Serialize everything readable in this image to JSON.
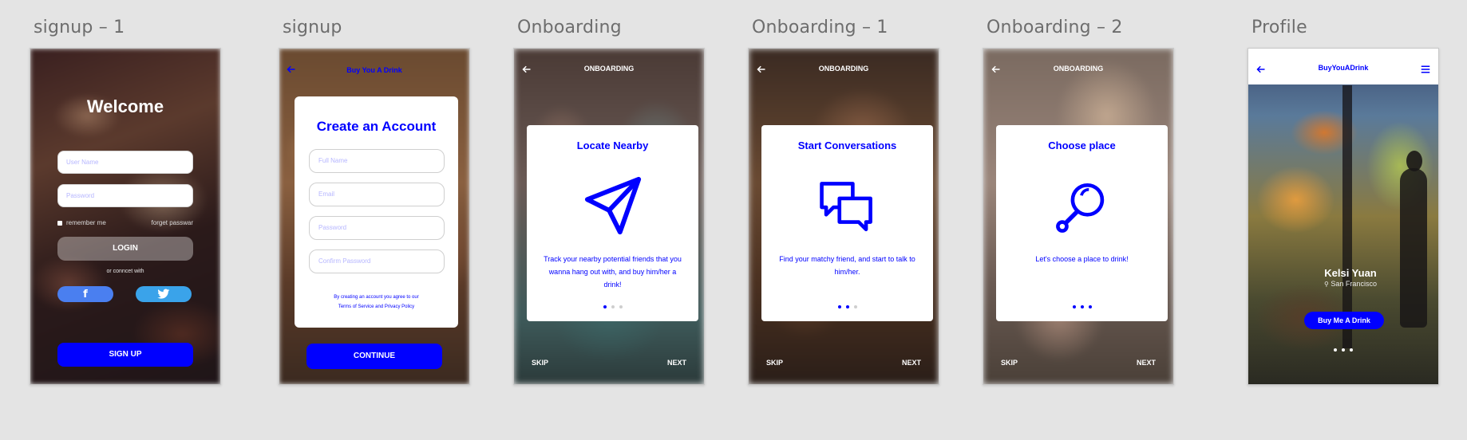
{
  "colors": {
    "accent": "#0000ff",
    "canvas": "#e4e4e4",
    "card": "#ffffff",
    "facebook": "#4a7ff0",
    "twitter": "#3aa3ea"
  },
  "artboards": {
    "signup1": {
      "title": "signup – 1",
      "welcome": "Welcome",
      "username_placeholder": "User Name",
      "password_placeholder": "Password",
      "remember_me": "remember me",
      "forget_password": "forget passwar",
      "login": "LOGIN",
      "connect_with": "or conncet with",
      "facebook_icon": "facebook-icon",
      "twitter_icon": "twitter-icon",
      "signup_button": "SIGN UP"
    },
    "signup": {
      "title": "signup",
      "header": "Buy You A Drink",
      "card_title": "Create an Account",
      "full_name": "Full Name",
      "email": "Email",
      "password": "Password",
      "confirm_password": "Confirm Password",
      "terms_line1": "By creating an account you agree to our",
      "terms_line2": "Terms of Service and Privacy Policy",
      "continue": "CONTINUE"
    },
    "onboarding": {
      "title": "Onboarding",
      "header": "ONBOARDING",
      "card_title": "Locate Nearby",
      "icon": "navigation-arrow-icon",
      "text": "Track your nearby potential friends that you wanna hang out with, and buy him/her a drink!",
      "page": 1,
      "pages": 3,
      "skip": "SKIP",
      "next": "NEXT"
    },
    "onboarding1": {
      "title": "Onboarding – 1",
      "header": "ONBOARDING",
      "card_title": "Start Conversations",
      "icon": "chat-bubbles-icon",
      "text": "Find your matchy friend, and start to talk to him/her.",
      "page": 2,
      "pages": 3,
      "skip": "SKIP",
      "next": "NEXT"
    },
    "onboarding2": {
      "title": "Onboarding – 2",
      "header": "ONBOARDING",
      "card_title": "Choose place",
      "icon": "magnifier-icon",
      "text": "Let's choose a place to drink!",
      "page": 3,
      "pages": 3,
      "skip": "SKIP",
      "next": "NEXT"
    },
    "profile": {
      "title": "Profile",
      "header": "BuyYouADrink",
      "name": "Kelsi Yuan",
      "location": "San Francisco",
      "button": "Buy Me A Drink",
      "menu_icon": "hamburger-menu-icon",
      "page": 1,
      "pages": 3
    }
  }
}
